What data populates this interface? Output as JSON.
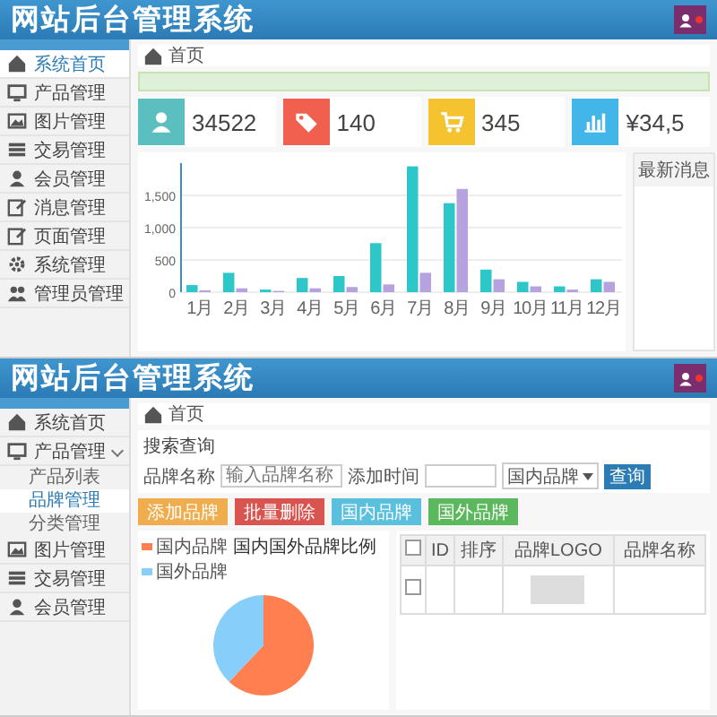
{
  "screens": [
    {
      "kind": "dashboard",
      "header": {
        "title": "网站后台管理系统"
      },
      "sidebar": {
        "items": [
          {
            "label": "系统首页",
            "selected": true,
            "kind": "home"
          },
          {
            "label": "产品管理",
            "selected": false,
            "kind": "monitor"
          },
          {
            "label": "图片管理",
            "selected": false,
            "kind": "picture"
          },
          {
            "label": "交易管理",
            "selected": false,
            "kind": "list"
          },
          {
            "label": "会员管理",
            "selected": false,
            "kind": "user"
          },
          {
            "label": "消息管理",
            "selected": false,
            "kind": "edit"
          },
          {
            "label": "页面管理",
            "selected": false,
            "kind": "edit"
          },
          {
            "label": "系统管理",
            "selected": false,
            "kind": "gear"
          },
          {
            "label": "管理员管理",
            "selected": false,
            "kind": "group"
          }
        ]
      },
      "breadcrumb": "首页",
      "stats": [
        {
          "value": "34522",
          "kind": "user",
          "color": "#5bbfc0"
        },
        {
          "value": "140",
          "kind": "tag",
          "color": "#f1604e"
        },
        {
          "value": "345",
          "kind": "cart",
          "color": "#f5c330"
        },
        {
          "value": "¥34,5",
          "kind": "bars",
          "color": "#42b6e8"
        }
      ],
      "chart": {
        "chart_data": {
          "type": "bar",
          "grid": true,
          "categories": [
            "1月",
            "2月",
            "3月",
            "4月",
            "5月",
            "6月",
            "7月",
            "8月",
            "9月",
            "10月",
            "11月",
            "12月"
          ],
          "yticks": [
            0,
            500,
            {
              "value": 1000,
              "label": "1,000"
            },
            {
              "value": 1500,
              "label": "1,500"
            }
          ],
          "ylim": [
            0,
            2000
          ],
          "series": [
            {
              "color": "#2ec7c9",
              "values": [
                110,
                300,
                40,
                220,
                250,
                760,
                1950,
                1380,
                350,
                160,
                90,
                200
              ]
            },
            {
              "color": "#b6a2de",
              "values": [
                30,
                60,
                20,
                60,
                80,
                120,
                300,
                1600,
                200,
                90,
                40,
                160
              ]
            }
          ]
        }
      },
      "news": {
        "title": "最新消息"
      }
    },
    {
      "kind": "brands",
      "header": {
        "title": "网站后台管理系统"
      },
      "sidebar": {
        "items": [
          {
            "label": "系统首页",
            "selected": false,
            "kind": "home"
          },
          {
            "label": "产品管理",
            "selected": false,
            "kind": "monitor",
            "expanded": true,
            "children": [
              {
                "label": "产品列表",
                "selected": false
              },
              {
                "label": "品牌管理",
                "selected": true
              },
              {
                "label": "分类管理",
                "selected": false
              }
            ]
          },
          {
            "label": "图片管理",
            "selected": false,
            "kind": "picture"
          },
          {
            "label": "交易管理",
            "selected": false,
            "kind": "list"
          },
          {
            "label": "会员管理",
            "selected": false,
            "kind": "user"
          }
        ]
      },
      "breadcrumb": "首页",
      "search": {
        "title": "搜索查询",
        "name_label": "品牌名称",
        "name_placeholder": "输入品牌名称",
        "date_label": "添加时间",
        "region_select": "国内品牌",
        "submit": "查询"
      },
      "actions": [
        {
          "label": "添加品牌",
          "color": "#f0ad4e"
        },
        {
          "label": "批量删除",
          "color": "#d9534f"
        },
        {
          "label": "国内品牌",
          "color": "#5bc0de"
        },
        {
          "label": "国外品牌",
          "color": "#5cb85c"
        }
      ],
      "pie": {
        "title": "国内国外品牌比例",
        "legend": [
          {
            "color": "#ff7f50"
          },
          {
            "color": "#87cefa"
          }
        ],
        "chart_data": {
          "type": "pie",
          "legend": "top-left",
          "categories": [
            "国内品牌",
            "国外品牌"
          ],
          "values": [
            62,
            38
          ]
        }
      },
      "table": {
        "select_all": {
          "checked": false
        },
        "columns": [
          "ID",
          "排序",
          "品牌LOGO",
          "品牌名称"
        ],
        "rows": [
          {
            "checked": false
          }
        ]
      }
    }
  ]
}
